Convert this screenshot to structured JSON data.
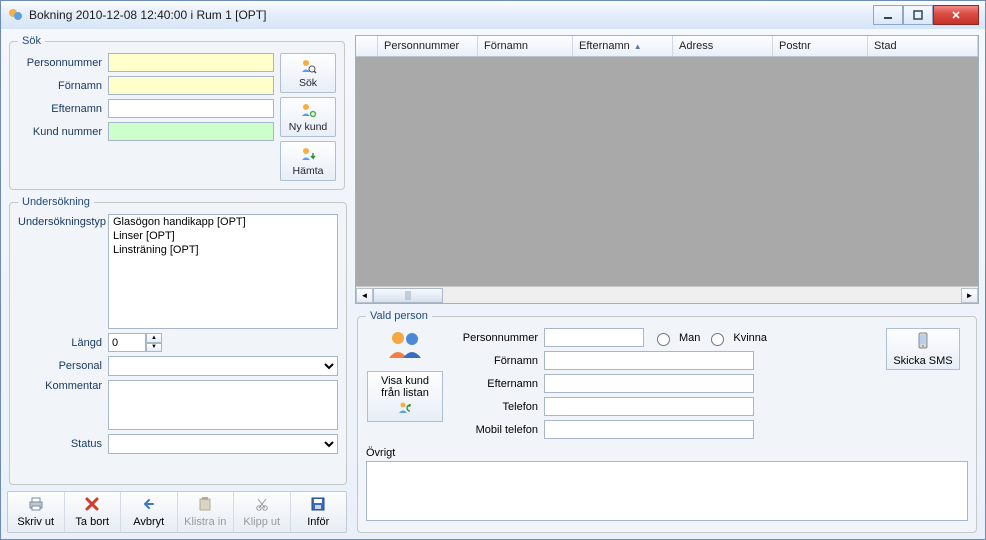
{
  "window": {
    "title": "Bokning 2010-12-08 12:40:00 i Rum 1 [OPT]"
  },
  "sok": {
    "legend": "Sök",
    "labels": {
      "personnummer": "Personnummer",
      "fornamn": "Förnamn",
      "efternamn": "Efternamn",
      "kundnummer": "Kund nummer"
    },
    "values": {
      "personnummer": "",
      "fornamn": "",
      "efternamn": "",
      "kundnummer": ""
    },
    "buttons": {
      "sok": "Sök",
      "nykund": "Ny kund",
      "hamta": "Hämta"
    }
  },
  "undersokning": {
    "legend": "Undersökning",
    "typ_label": "Undersökningstyp",
    "types": [
      "Glasögon handikapp [OPT]",
      "Linser [OPT]",
      "Linsträning [OPT]"
    ],
    "langd_label": "Längd",
    "langd_value": "0",
    "personal_label": "Personal",
    "personal_value": "",
    "kommentar_label": "Kommentar",
    "kommentar_value": "",
    "status_label": "Status",
    "status_value": ""
  },
  "toolbar": {
    "skrivut": "Skriv ut",
    "tabort": "Ta bort",
    "avbryt": "Avbryt",
    "klistrain": "Klistra in",
    "klipput": "Klipp ut",
    "infor": "Inför"
  },
  "table": {
    "columns": [
      "Personnummer",
      "Förnamn",
      "Efternamn",
      "Adress",
      "Postnr",
      "Stad"
    ],
    "sort_col": "Efternamn"
  },
  "vald": {
    "legend": "Vald person",
    "visa_btn_line1": "Visa kund",
    "visa_btn_line2": "från listan",
    "labels": {
      "personnummer": "Personnummer",
      "fornamn": "Förnamn",
      "efternamn": "Efternamn",
      "telefon": "Telefon",
      "mobil": "Mobil telefon",
      "man": "Man",
      "kvinna": "Kvinna",
      "ovrigt": "Övrigt"
    },
    "values": {
      "personnummer": "",
      "fornamn": "",
      "efternamn": "",
      "telefon": "",
      "mobil": "",
      "ovrigt": ""
    },
    "sms_label": "Skicka SMS"
  }
}
